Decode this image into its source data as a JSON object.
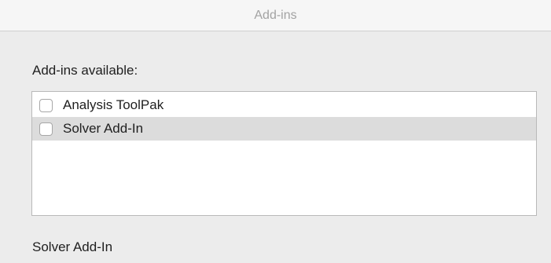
{
  "window": {
    "title": "Add-ins"
  },
  "available_label": "Add-ins available:",
  "addins": [
    {
      "label": "Analysis ToolPak",
      "checked": false,
      "selected": false
    },
    {
      "label": "Solver Add-In",
      "checked": false,
      "selected": true
    }
  ],
  "description": "Solver Add-In"
}
